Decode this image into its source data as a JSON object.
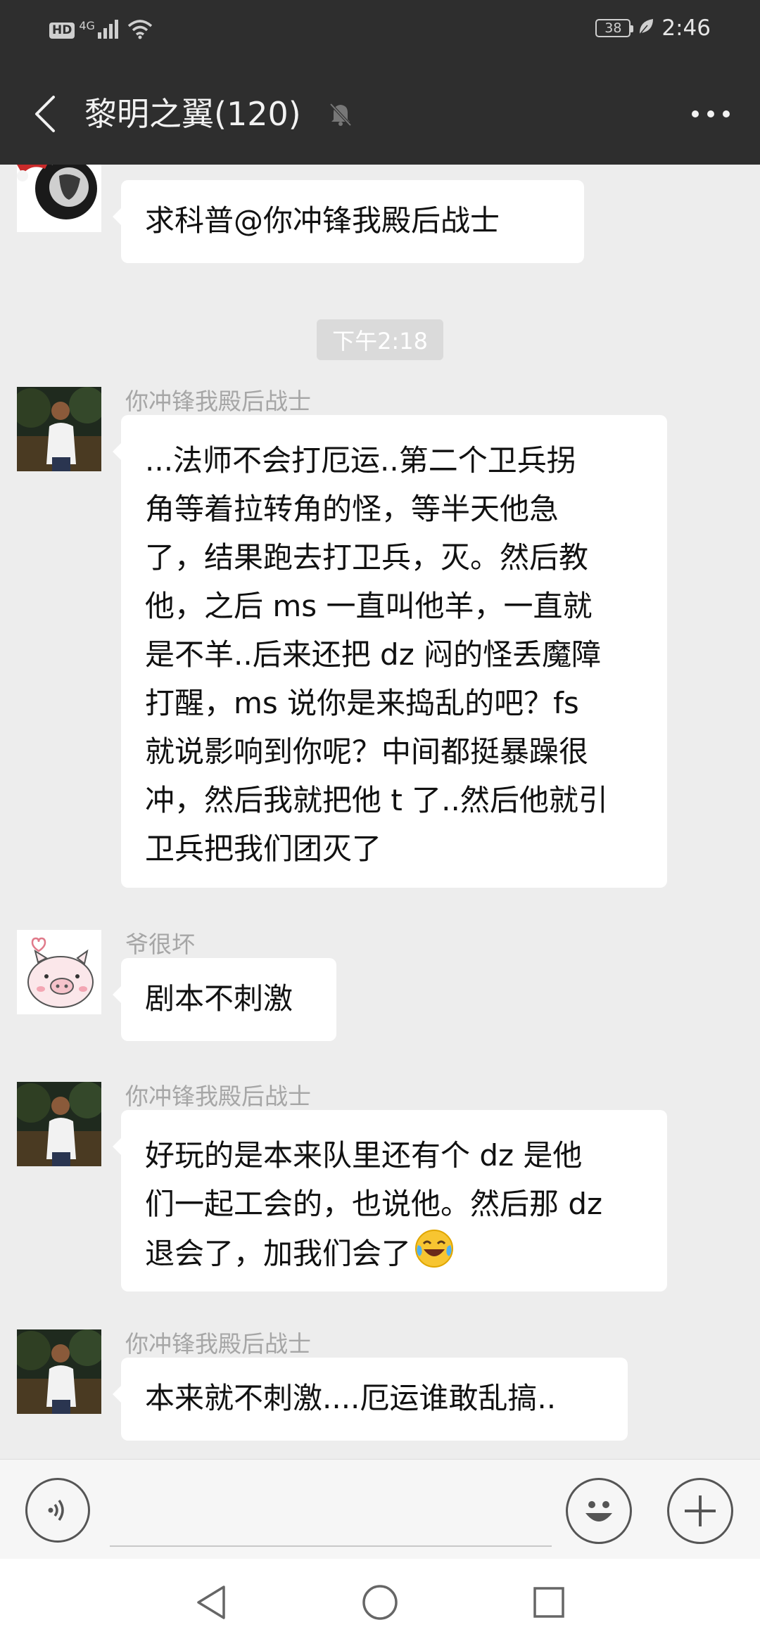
{
  "status_bar": {
    "hd_label": "HD",
    "network_label": "4G",
    "battery_level": "38",
    "time": "2:46"
  },
  "header": {
    "title": "黎明之翼(120)",
    "icons": [
      "back-icon",
      "mute-bell-icon",
      "more-icon"
    ]
  },
  "chat": {
    "time_divider": "下午2:18",
    "messages": [
      {
        "sender": "",
        "text": "求科普@你冲锋我殿后战士",
        "avatar": "santa-avatar"
      },
      {
        "sender": "你冲锋我殿后战士",
        "lines": [
          "...法师不会打厄运..第二个卫兵拐",
          "角等着拉转角的怪，等半天他急",
          "了，结果跑去打卫兵，灭。然后教",
          "他，之后 ms 一直叫他羊，一直就",
          "是不羊..后来还把 dz 闷的怪丢魔障",
          "打醒，ms 说你是来捣乱的吧？fs",
          "就说影响到你呢？中间都挺暴躁很",
          "冲，然后我就把他 t 了..然后他就引",
          "卫兵把我们团灭了"
        ],
        "avatar": "man-photo-avatar"
      },
      {
        "sender": "爷很坏",
        "text": "剧本不刺激",
        "avatar": "pig-avatar"
      },
      {
        "sender": "你冲锋我殿后战士",
        "lines": [
          "好玩的是本来队里还有个 dz 是他",
          "们一起工会的，也说他。然后那 dz",
          "退会了，加我们会了"
        ],
        "emoji": "laughing-tears-emoji",
        "avatar": "man-photo-avatar"
      },
      {
        "sender": "你冲锋我殿后战士",
        "text": "本来就不刺激....厄运谁敢乱搞..",
        "avatar": "man-photo-avatar"
      }
    ]
  },
  "input_bar": {
    "placeholder": "",
    "icons": [
      "voice-icon",
      "emoji-icon",
      "plus-icon"
    ]
  },
  "nav_bar": {
    "icons": [
      "nav-back-icon",
      "nav-home-icon",
      "nav-recents-icon"
    ]
  },
  "colors": {
    "header_bg": "#2e2e2e",
    "chat_bg": "#ededed",
    "bubble_bg": "#ffffff",
    "name_gray": "#a6a6a6"
  }
}
